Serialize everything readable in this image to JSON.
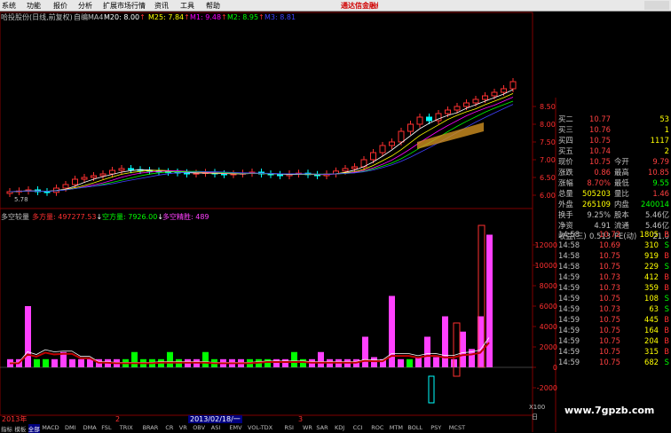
{
  "menu": {
    "items": [
      "系统",
      "功能",
      "报价",
      "分析",
      "扩展市场行情",
      "资讯",
      "工具",
      "帮助"
    ],
    "promo": "通达信金融终端"
  },
  "header": {
    "stock_title": "哈投股份(日线,前复权)",
    "indicator": "自编MA4",
    "ma_values": [
      {
        "label": "M20: 8.00",
        "arrow": "↑",
        "color": "#ffffff"
      },
      {
        "label": "M25: 7.84",
        "arrow": "↑",
        "color": "#ffff00"
      },
      {
        "label": "M1: 9.48",
        "arrow": "↑",
        "color": "#ff00ff"
      },
      {
        "label": "M2: 8.95",
        "arrow": "↑",
        "color": "#00ff00"
      },
      {
        "label": "M3: 8.81",
        "arrow": "",
        "color": "#4040ff"
      }
    ]
  },
  "price_axis": [
    "8.50",
    "8.00",
    "7.50",
    "7.00",
    "6.50",
    "6.00"
  ],
  "low_label": "5.78",
  "sub_header": {
    "title": "多空较量",
    "long": {
      "label": "多方量: 497277.53",
      "arrow": "↓"
    },
    "short": {
      "label": "空方量: 7926.00",
      "arrow": "↓"
    },
    "net": {
      "label": "多空精胜: 489"
    }
  },
  "vol_axis": [
    "12000",
    "10000",
    "8000",
    "6000",
    "4000",
    "2000",
    "0",
    "-2000"
  ],
  "vol_axis_unit": "X100",
  "vol_axis_corner": "日",
  "chart_data": {
    "type": "bar",
    "title": "多空较量",
    "series": [
      {
        "name": "多方量",
        "color": "#ff40ff",
        "values": [
          800,
          800,
          6000,
          800,
          6000,
          800,
          1500,
          800,
          800,
          800,
          800,
          800,
          800,
          800,
          800,
          800,
          800,
          1500,
          800,
          800,
          800,
          800,
          800,
          800,
          800,
          800,
          800,
          800,
          1500,
          1500,
          800,
          800,
          800,
          800,
          800,
          1500,
          800,
          800,
          800,
          800,
          3000,
          1000,
          800,
          7000,
          800,
          800,
          1000,
          3000,
          1000,
          5000,
          800,
          3500,
          1800,
          5000,
          13000
        ]
      },
      {
        "name": "空方量",
        "color": "#00ff00",
        "values": [
          800,
          800,
          800,
          800,
          800,
          800,
          1500,
          1500,
          800,
          800,
          800,
          1500,
          800,
          800,
          1500,
          800,
          800,
          800,
          1500,
          800,
          800,
          800,
          1500,
          800,
          800,
          800,
          800,
          800,
          800,
          800,
          800,
          800,
          1500,
          800,
          800,
          800,
          1500,
          800,
          1500,
          800,
          800,
          1500,
          800,
          1500,
          1500,
          800,
          1000,
          1500,
          800,
          3000,
          1500,
          1000,
          800,
          1000,
          800
        ]
      }
    ],
    "ylim": [
      -2000,
      13000
    ]
  },
  "quote": {
    "rows": [
      {
        "left": "买二",
        "val": "10.77",
        "right": "",
        "rval": "53"
      },
      {
        "left": "买三",
        "val": "10.76",
        "right": "",
        "rval": "1"
      },
      {
        "left": "买四",
        "val": "10.75",
        "right": "",
        "rval": "1117"
      },
      {
        "left": "买五",
        "val": "10.74",
        "right": "",
        "rval": "2"
      },
      {
        "left": "现价",
        "val": "10.75",
        "right": "今开",
        "rval": "9.79"
      },
      {
        "left": "涨跌",
        "val": "0.86",
        "right": "最高",
        "rval": "10.85"
      },
      {
        "left": "涨幅",
        "val": "8.70%",
        "right": "最低",
        "rval": "9.55"
      },
      {
        "left": "总量",
        "val": "505203",
        "right": "量比",
        "rval": "1.46"
      },
      {
        "left": "外盘",
        "val": "265109",
        "right": "内盘",
        "rval": "240014"
      },
      {
        "left": "换手",
        "val": "9.25%",
        "right": "股本",
        "rval": "5.46亿"
      },
      {
        "left": "净资",
        "val": "4.91",
        "right": "流通",
        "rval": "5.46亿"
      },
      {
        "left": "收益(三)",
        "val": "0.513",
        "right": "PE(动)",
        "rval": "21.0"
      }
    ]
  },
  "ticks": [
    {
      "time": "14:58",
      "price": "10.72",
      "vol": "1805",
      "bs": "B"
    },
    {
      "time": "14:58",
      "price": "10.69",
      "vol": "310",
      "bs": "S"
    },
    {
      "time": "14:58",
      "price": "10.75",
      "vol": "919",
      "bs": "B"
    },
    {
      "time": "14:58",
      "price": "10.75",
      "vol": "229",
      "bs": "S"
    },
    {
      "time": "14:59",
      "price": "10.73",
      "vol": "412",
      "bs": "B"
    },
    {
      "time": "14:59",
      "price": "10.73",
      "vol": "359",
      "bs": "B"
    },
    {
      "time": "14:59",
      "price": "10.75",
      "vol": "108",
      "bs": "S"
    },
    {
      "time": "14:59",
      "price": "10.73",
      "vol": "63",
      "bs": "S"
    },
    {
      "time": "14:59",
      "price": "10.75",
      "vol": "445",
      "bs": "B"
    },
    {
      "time": "14:59",
      "price": "10.75",
      "vol": "164",
      "bs": "B"
    },
    {
      "time": "14:59",
      "price": "10.75",
      "vol": "204",
      "bs": "B"
    },
    {
      "time": "14:59",
      "price": "10.75",
      "vol": "315",
      "bs": "B"
    },
    {
      "time": "14:59",
      "price": "10.75",
      "vol": "682",
      "bs": "S"
    }
  ],
  "date_axis": {
    "labels": [
      "2013年",
      "2",
      "3"
    ],
    "cursor_date": "2013/02/18/一"
  },
  "tabs": [
    "指标",
    "模板",
    "全部",
    "MACD",
    "DMI",
    "DMA",
    "FSL",
    "TRIX",
    "BRAR",
    "CR",
    "VR",
    "OBV",
    "ASI",
    "EMV",
    "VOL-TDX",
    "RSI",
    "WR",
    "SAR",
    "KDJ",
    "CCI",
    "ROC",
    "MTM",
    "BOLL",
    "PSY",
    "MCST"
  ],
  "watermark": "www.7gpzb.com",
  "colors": {
    "up": "#ff3030",
    "down": "#00ffff",
    "vol_up": "#ff40ff",
    "vol_down": "#00ff00",
    "price_red": "#ff4040",
    "label_yellow": "#ffff00",
    "grid": "#800000"
  }
}
